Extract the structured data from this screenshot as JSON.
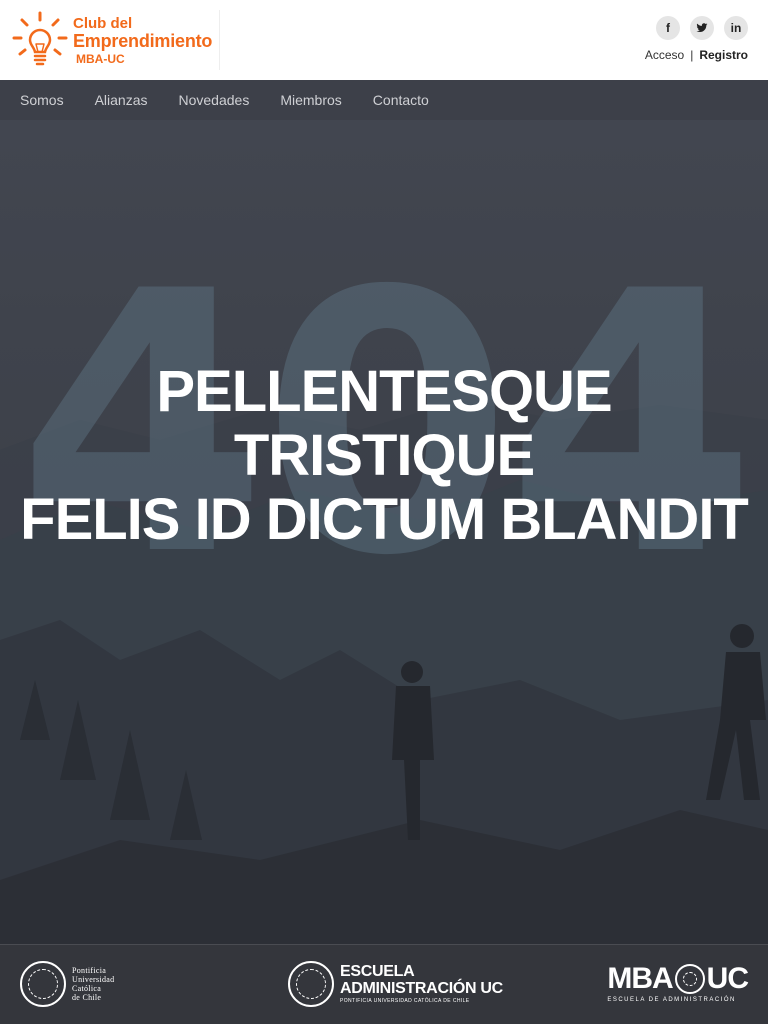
{
  "header": {
    "logo": {
      "line1": "Club del",
      "line2": "Emprendimiento",
      "line3": "MBA-UC",
      "icon": "lightbulb-icon",
      "color": "#f26a1b"
    },
    "social": [
      {
        "name": "facebook",
        "glyph": "f",
        "icon": "facebook-icon"
      },
      {
        "name": "twitter",
        "icon": "twitter-icon"
      },
      {
        "name": "linkedin",
        "glyph": "in",
        "icon": "linkedin-icon"
      }
    ],
    "auth": {
      "login": "Acceso",
      "separator": "|",
      "register": "Registro"
    }
  },
  "nav": {
    "items": [
      "Somos",
      "Alianzas",
      "Novedades",
      "Miembros",
      "Contacto"
    ]
  },
  "hero": {
    "background_number": "404",
    "headline_line1": "PELLENTESQUE TRISTIQUE",
    "headline_line2": "FELIS ID DICTUM BLANDIT"
  },
  "footer": {
    "puc": {
      "line1": "Pontificia",
      "line2": "Universidad",
      "line3": "Católica",
      "line4": "de Chile"
    },
    "escuela": {
      "line1": "ESCUELA",
      "line2": "ADMINISTRACIÓN UC",
      "line3": "PONTIFICIA UNIVERSIDAD CATÓLICA DE CHILE"
    },
    "mba": {
      "left": "MBA",
      "right": "UC",
      "sub": "ESCUELA DE ADMINISTRACIÓN"
    }
  },
  "colors": {
    "accent": "#f26a1b",
    "nav_bg": "#3d4049",
    "footer_bg": "#34363c"
  }
}
